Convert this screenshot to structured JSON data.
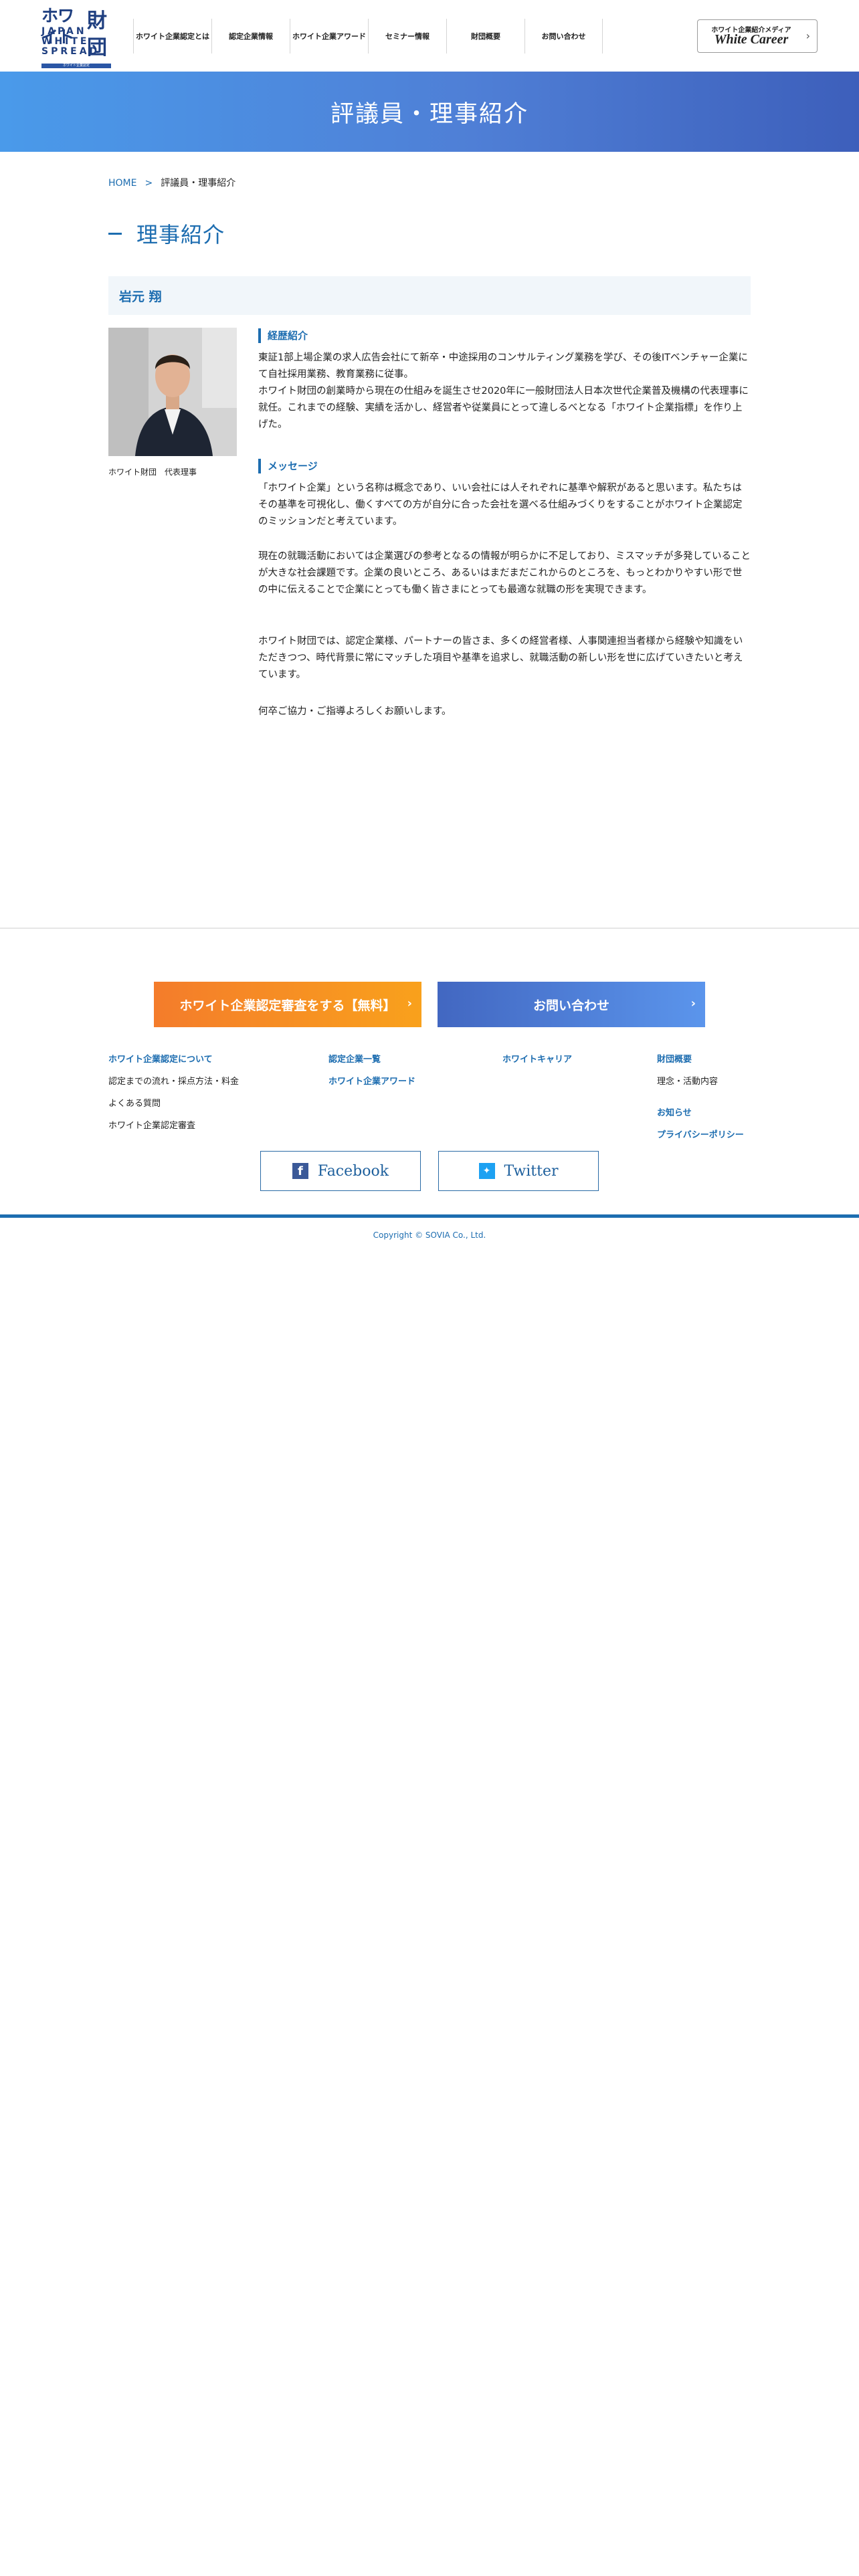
{
  "logo": {
    "top_text": "ホワイト",
    "kanji": "財団",
    "english_lines": [
      "JAPAN",
      "WHITE",
      "SPREAD"
    ],
    "tagline": "ホワイト企業認定"
  },
  "nav": {
    "items": [
      {
        "label": "ホワイト企業認定とは"
      },
      {
        "label": "認定企業情報"
      },
      {
        "label": "ホワイト企業アワード"
      },
      {
        "label": "セミナー情報"
      },
      {
        "label": "財団概要"
      },
      {
        "label": "お問い合わせ"
      }
    ]
  },
  "white_career": {
    "top_label": "ホワイト企業紹介メディア",
    "logo_text": "White Career"
  },
  "hero": {
    "title": "評議員・理事紹介"
  },
  "breadcrumb": {
    "home": "HOME",
    "separator": ">",
    "current": "評議員・理事紹介"
  },
  "section": {
    "title": "理事紹介",
    "person": {
      "name": "岩元 翔",
      "caption": "ホワイト財団　代表理事",
      "career_heading": "経歴紹介",
      "career_text": "東証1部上場企業の求人広告会社にて新卒・中途採用のコンサルティング業務を学び、その後ITベンチャー企業にて自社採用業務、教育業務に従事。\nホワイト財団の創業時から現在の仕組みを誕生させ2020年に一般財団法人日本次世代企業普及機構の代表理事に就任。これまでの経験、実績を活かし、経営者や従業員にとって違しるべとなる「ホワイト企業指標」を作り上げた。",
      "message_heading": "メッセージ",
      "message_paragraphs": [
        "「ホワイト企業」という名称は概念であり、いい会社には人それぞれに基準や解釈があると思います。私たちはその基準を可視化し、働くすべての方が自分に合った会社を選べる仕組みづくりをすることがホワイト企業認定のミッションだと考えています。",
        "現在の就職活動においては企業選びの参考となるの情報が明らかに不足しており、ミスマッチが多発していることが大きな社会課題です。企業の良いところ、あるいはまだまだこれからのところを、もっとわかりやすい形で世の中に伝えることで企業にとっても働く皆さまにとっても最適な就職の形を実現できます。",
        "ホワイト財団では、認定企業様、パートナーの皆さま、多くの経営者様、人事関連担当者様から経験や知識をいただきつつ、時代背景に常にマッチした項目や基準を追求し、就職活動の新しい形を世に広げていきたいと考えています。",
        "何卒ご協力・ご指導よろしくお願いします。"
      ]
    }
  },
  "footer": {
    "cta_apply": "ホワイト企業認定審査をする【無料】",
    "cta_contact": "お問い合わせ",
    "links": {
      "about": "ホワイト企業認定について",
      "flow": "認定までの流れ・採点方法・料金",
      "faq": "よくある質問",
      "review": "ホワイト企業認定審査",
      "certified_list": "認定企業一覧",
      "award": "ホワイト企業アワード",
      "white_career": "ホワイトキャリア",
      "foundation": "財団概要",
      "philosophy": "理念・活動内容",
      "news": "お知らせ",
      "privacy": "プライバシーポリシー"
    },
    "facebook": "Facebook",
    "twitter": "Twitter",
    "copyright": "Copyright © SOVIA Co., Ltd."
  },
  "colors": {
    "brand_blue": "#1d6db0",
    "logo_navy": "#1f3f80",
    "cta_orange": "#f47c2b",
    "cta_blue": "#4267c1",
    "name_bar_bg": "#f1f6fa"
  }
}
